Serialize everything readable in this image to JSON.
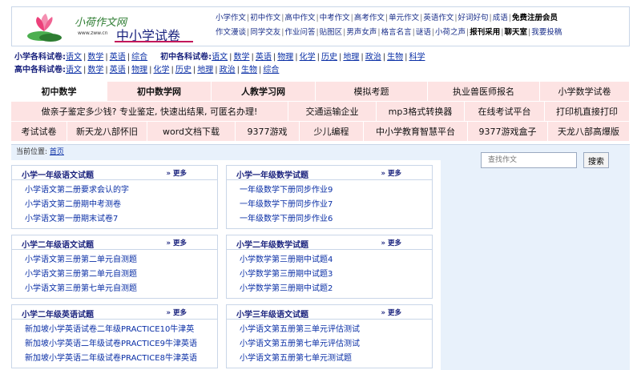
{
  "logo": {
    "brand": "小荷作文网",
    "url": "www.zww.cn",
    "title": "中小学试卷"
  },
  "top_nav": {
    "row1": [
      {
        "label": "小学作文",
        "bold": false
      },
      {
        "label": "初中作文",
        "bold": false
      },
      {
        "label": "高中作文",
        "bold": false
      },
      {
        "label": "中考作文",
        "bold": false
      },
      {
        "label": "高考作文",
        "bold": false
      },
      {
        "label": "单元作文",
        "bold": false
      },
      {
        "label": "英语作文",
        "bold": false
      },
      {
        "label": "好词好句",
        "bold": false
      },
      {
        "label": "成语",
        "bold": false
      },
      {
        "label": "免费注册会员",
        "bold": true
      }
    ],
    "row2": [
      {
        "label": "作文漫谈",
        "bold": false
      },
      {
        "label": "同学交友",
        "bold": false
      },
      {
        "label": "作业问答",
        "bold": false
      },
      {
        "label": "贴图区",
        "bold": false
      },
      {
        "label": "男声女声",
        "bold": false
      },
      {
        "label": "格言名言",
        "bold": false
      },
      {
        "label": "谜语",
        "bold": false
      },
      {
        "label": "小荷之声",
        "bold": false
      },
      {
        "label": "报刊采用",
        "bold": true
      },
      {
        "label": "聊天室",
        "bold": true
      },
      {
        "label": "我要投稿",
        "bold": false
      }
    ]
  },
  "subjects": {
    "row1": [
      {
        "label": "小学各科试卷:",
        "links": [
          "语文",
          "数学",
          "英语",
          "综合"
        ]
      },
      {
        "label": "初中各科试卷:",
        "links": [
          "语文",
          "数学",
          "英语",
          "物理",
          "化学",
          "历史",
          "地理",
          "政治",
          "生物",
          "科学"
        ]
      }
    ],
    "row2": [
      {
        "label": "高中各科试卷:",
        "links": [
          "语文",
          "数学",
          "英语",
          "物理",
          "化学",
          "历史",
          "地理",
          "政治",
          "生物",
          "综合"
        ]
      }
    ]
  },
  "ad_rows": [
    [
      {
        "label": "初中数学",
        "active": true,
        "bold": true
      },
      {
        "label": "初中数学网",
        "bold": true
      },
      {
        "label": "人教学习网",
        "bold": true
      },
      {
        "label": "模拟考题"
      },
      {
        "label": "执业兽医师报名"
      },
      {
        "label": "小学数学试卷"
      }
    ],
    [
      {
        "label": "做亲子鉴定多少钱? 专业鉴定, 快速出结果, 可匿名办理!"
      },
      {
        "label": "交通运输企业"
      },
      {
        "label": "mp3格式转换器"
      },
      {
        "label": "在线考试平台"
      },
      {
        "label": "打印机直接打印"
      }
    ],
    [
      {
        "label": "考试试卷"
      },
      {
        "label": "新天龙八部怀旧"
      },
      {
        "label": "word文档下载"
      },
      {
        "label": "9377游戏"
      },
      {
        "label": "少儿编程"
      },
      {
        "label": "中小学教育智慧平台"
      },
      {
        "label": "9377游戏盒子"
      },
      {
        "label": "天龙八部高爆版"
      }
    ]
  ],
  "breadcrumb": {
    "prefix": "当前位置:",
    "home": "首页"
  },
  "search": {
    "placeholder": "查找作文",
    "button": "搜索"
  },
  "more_label": "» 更多",
  "panels": [
    {
      "title": "小学一年级语文试题",
      "items": [
        "小学语文第二册要求会认的字",
        "小学语文第二册期中考测卷",
        "小学语文第一册期末试卷7"
      ]
    },
    {
      "title": "小学一年级数学试题",
      "items": [
        "一年级数学下册同步作业9",
        "一年级数学下册同步作业7",
        "一年级数学下册同步作业6"
      ]
    },
    {
      "title": "小学二年级语文试题",
      "items": [
        "小学语文第三册第二单元自测题",
        "小学语文第三册第二单元自测题",
        "小学语文第三册第七单元自测题"
      ]
    },
    {
      "title": "小学二年级数学试题",
      "items": [
        "小学数学第三册期中试题4",
        "小学数学第三册期中试题3",
        "小学数学第三册期中试题2"
      ]
    },
    {
      "title": "小学二年级英语试题",
      "items": [
        "新加坡小学英语试卷二年级PRACTICE10牛津英",
        "新加坡小学英语二年级试卷PRACTICE9牛津英语",
        "新加坡小学英语二年级试卷PRACTICE8牛津英语"
      ]
    },
    {
      "title": "小学三年级语文试题",
      "items": [
        "小学语文第五册第三单元评估测试",
        "小学语文第五册第七单元评估测试",
        "小学语文第五册第七单元测试题"
      ]
    }
  ],
  "colors": {
    "ad_bg": "#fde3e3",
    "link": "#0a2fa6",
    "title": "#1a237e",
    "panel_border": "#c9d6e8",
    "sidebar_bg": "#e8f1fb"
  }
}
